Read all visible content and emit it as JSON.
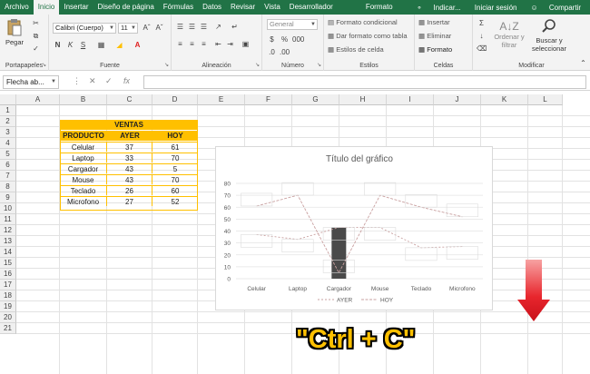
{
  "tabs": [
    "Archivo",
    "Inicio",
    "Insertar",
    "Diseño de página",
    "Fórmulas",
    "Datos",
    "Revisar",
    "Vista",
    "Desarrollador"
  ],
  "active_tab": "Inicio",
  "context_tab": "Formato",
  "tell_me": "Indicar...",
  "signin": "Iniciar sesión",
  "share": "Compartir",
  "ribbon": {
    "paste": "Pegar",
    "clipboard": "Portapapeles",
    "font_name": "Calibri (Cuerpo)",
    "font_size": "11",
    "font": "Fuente",
    "alignment": "Alineación",
    "number_format": "General",
    "number": "Número",
    "cond_format": "Formato condicional",
    "table_format": "Dar formato como tabla",
    "cell_styles": "Estilos de celda",
    "styles": "Estilos",
    "insert": "Insertar",
    "delete": "Eliminar",
    "format": "Formato",
    "cells": "Celdas",
    "sort": "Ordenar y filtrar",
    "find": "Buscar y seleccionar",
    "modify": "Modificar"
  },
  "namebox": "Flecha ab...",
  "columns": [
    "A",
    "B",
    "C",
    "D",
    "E",
    "F",
    "G",
    "H",
    "I",
    "J",
    "K",
    "L"
  ],
  "rows": [
    "1",
    "2",
    "3",
    "4",
    "5",
    "6",
    "7",
    "8",
    "9",
    "10",
    "11",
    "12",
    "13",
    "14",
    "15",
    "16",
    "17",
    "18",
    "19",
    "20",
    "21"
  ],
  "table": {
    "title": "VENTAS",
    "headers": [
      "PRODUCTO",
      "AYER",
      "HOY"
    ],
    "rows": [
      [
        "Celular",
        "37",
        "61"
      ],
      [
        "Laptop",
        "33",
        "70"
      ],
      [
        "Cargador",
        "43",
        "5"
      ],
      [
        "Mouse",
        "43",
        "70"
      ],
      [
        "Teclado",
        "26",
        "60"
      ],
      [
        "Microfono",
        "27",
        "52"
      ]
    ]
  },
  "chart_data": {
    "type": "line",
    "title": "Título del gráfico",
    "categories": [
      "Celular",
      "Laptop",
      "Cargador",
      "Mouse",
      "Teclado",
      "Microfono"
    ],
    "series": [
      {
        "name": "AYER",
        "values": [
          37,
          33,
          43,
          43,
          26,
          27
        ]
      },
      {
        "name": "HOY",
        "values": [
          61,
          70,
          5,
          70,
          60,
          52
        ]
      }
    ],
    "ylim": [
      0,
      80
    ],
    "yticks": [
      0,
      10,
      20,
      30,
      40,
      50,
      60,
      70,
      80
    ],
    "grid": true,
    "legend": "bottom",
    "selected_category": "Cargador",
    "selected_bar_value": 43,
    "bar_color": "#4a4a4a",
    "line_color": "#c9a0a0"
  },
  "overlay_text": "\"Ctrl + C\"",
  "colors": {
    "excel_green": "#217346",
    "header_fill": "#ffc000",
    "arrow_red": "#e8262d"
  }
}
